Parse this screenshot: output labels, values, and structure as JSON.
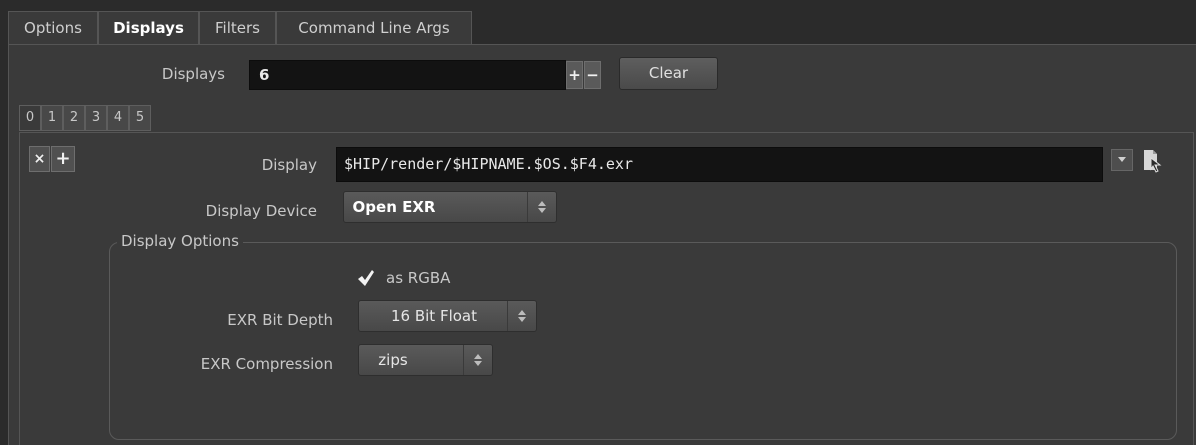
{
  "tabs": [
    {
      "label": "Options",
      "active": false
    },
    {
      "label": "Displays",
      "active": true
    },
    {
      "label": "Filters",
      "active": false
    },
    {
      "label": "Command Line Args",
      "active": false
    }
  ],
  "displays_count": {
    "label": "Displays",
    "value": "6",
    "add_label": "+",
    "remove_label": "−",
    "clear_label": "Clear"
  },
  "display_tabs": [
    "0",
    "1",
    "2",
    "3",
    "4",
    "5"
  ],
  "instance_controls": {
    "remove_label": "×",
    "add_label": "+"
  },
  "display": {
    "label": "Display",
    "value": "$HIP/render/$HIPNAME.$OS.$F4.exr",
    "menu_icon": "dropdown-arrow-icon",
    "file_icon": "file-chooser-icon"
  },
  "display_device": {
    "label": "Display Device",
    "value": "Open EXR"
  },
  "display_options": {
    "title": "Display Options",
    "as_rgba": {
      "label": "as RGBA",
      "checked": true
    },
    "exr_bit_depth": {
      "label": "EXR Bit Depth",
      "value": "16 Bit Float"
    },
    "exr_compression": {
      "label": "EXR Compression",
      "value": "zips"
    }
  },
  "colors": {
    "background": "#2b2b2b",
    "panel": "#3a3a3a",
    "field": "#131313"
  }
}
